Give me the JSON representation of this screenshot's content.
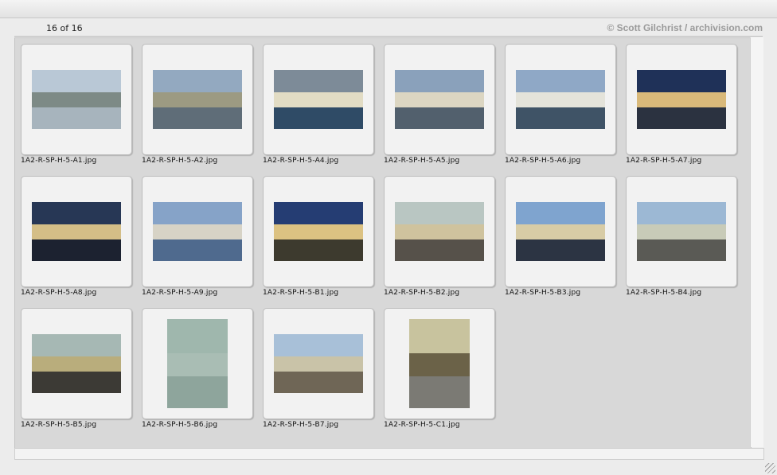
{
  "viewer": {
    "count_text": "16 of 16",
    "credit_text": "© Scott Gilchrist / archivision.com"
  },
  "thumbnails": [
    {
      "filename": "1A2-R-SP-H-5-A1.jpg",
      "orientation": "landscape",
      "sky": "#b9c8d6",
      "building": "#7d8a86",
      "ground": "#a7b4bd"
    },
    {
      "filename": "1A2-R-SP-H-5-A2.jpg",
      "orientation": "landscape",
      "sky": "#93a9c0",
      "building": "#9c9a82",
      "ground": "#5f6d78"
    },
    {
      "filename": "1A2-R-SP-H-5-A4.jpg",
      "orientation": "landscape",
      "sky": "#7d8b98",
      "building": "#e2dcc4",
      "ground": "#2f4b66"
    },
    {
      "filename": "1A2-R-SP-H-5-A5.jpg",
      "orientation": "landscape",
      "sky": "#8aa1bb",
      "building": "#dcd6c2",
      "ground": "#52606d"
    },
    {
      "filename": "1A2-R-SP-H-5-A6.jpg",
      "orientation": "landscape",
      "sky": "#8fa8c6",
      "building": "#e4e3da",
      "ground": "#3f5366"
    },
    {
      "filename": "1A2-R-SP-H-5-A7.jpg",
      "orientation": "landscape",
      "sky": "#1f3158",
      "building": "#d9b97a",
      "ground": "#2b3240"
    },
    {
      "filename": "1A2-R-SP-H-5-A8.jpg",
      "orientation": "landscape",
      "sky": "#273755",
      "building": "#d4be87",
      "ground": "#1c2230"
    },
    {
      "filename": "1A2-R-SP-H-5-A9.jpg",
      "orientation": "landscape",
      "sky": "#86a3c8",
      "building": "#d7d3c6",
      "ground": "#4f6a8e"
    },
    {
      "filename": "1A2-R-SP-H-5-B1.jpg",
      "orientation": "landscape",
      "sky": "#253d73",
      "building": "#dcc282",
      "ground": "#3d3a2e"
    },
    {
      "filename": "1A2-R-SP-H-5-B2.jpg",
      "orientation": "landscape",
      "sky": "#b9c6c2",
      "building": "#cfc39e",
      "ground": "#56514a"
    },
    {
      "filename": "1A2-R-SP-H-5-B3.jpg",
      "orientation": "landscape",
      "sky": "#7fa4cf",
      "building": "#d8cca6",
      "ground": "#2c3443"
    },
    {
      "filename": "1A2-R-SP-H-5-B4.jpg",
      "orientation": "landscape",
      "sky": "#9cb8d4",
      "building": "#c8cbb8",
      "ground": "#5a5a55"
    },
    {
      "filename": "1A2-R-SP-H-5-B5.jpg",
      "orientation": "landscape",
      "sky": "#a6b8b4",
      "building": "#b9ad7c",
      "ground": "#3c3a35"
    },
    {
      "filename": "1A2-R-SP-H-5-B6.jpg",
      "orientation": "portrait",
      "sky": "#9fb7ad",
      "building": "#a9bdb4",
      "ground": "#8ea59c"
    },
    {
      "filename": "1A2-R-SP-H-5-B7.jpg",
      "orientation": "landscape",
      "sky": "#a8c0d8",
      "building": "#c9c3a8",
      "ground": "#6f6656"
    },
    {
      "filename": "1A2-R-SP-H-5-C1.jpg",
      "orientation": "portrait",
      "sky": "#c8c39e",
      "building": "#6b6248",
      "ground": "#7b7a74"
    }
  ]
}
